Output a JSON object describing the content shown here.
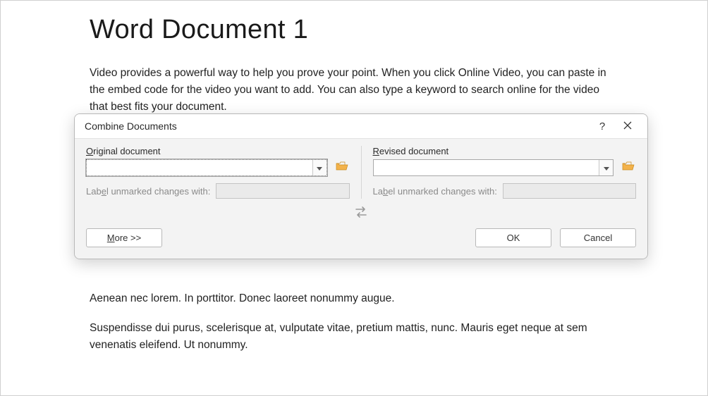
{
  "document": {
    "title": "Word Document 1",
    "para1": "Video provides a powerful way to help you prove your point. When you click Online Video, you can paste in the embed code for the video you want to add. You can also type a keyword to search online for the video that best fits your document.",
    "para2": "Aenean nec lorem. In porttitor. Donec laoreet nonummy augue.",
    "para3": "Suspendisse dui purus, scelerisque at, vulputate vitae, pretium mattis, nunc. Mauris eget neque at sem venenatis eleifend. Ut nonummy."
  },
  "dialog": {
    "title": "Combine Documents",
    "help_symbol": "?",
    "original": {
      "label_pre": "O",
      "label_post": "riginal document",
      "value": "",
      "label_changes_pre": "Lab",
      "label_changes_mid": "e",
      "label_changes_post": "l unmarked changes with:",
      "changes_value": ""
    },
    "revised": {
      "label_pre": "R",
      "label_post": "evised document",
      "value": "",
      "label_changes_pre": "La",
      "label_changes_mid": "b",
      "label_changes_post": "el unmarked changes with:",
      "changes_value": ""
    },
    "buttons": {
      "more_pre": "M",
      "more_post": "ore >>",
      "ok": "OK",
      "cancel": "Cancel"
    }
  }
}
